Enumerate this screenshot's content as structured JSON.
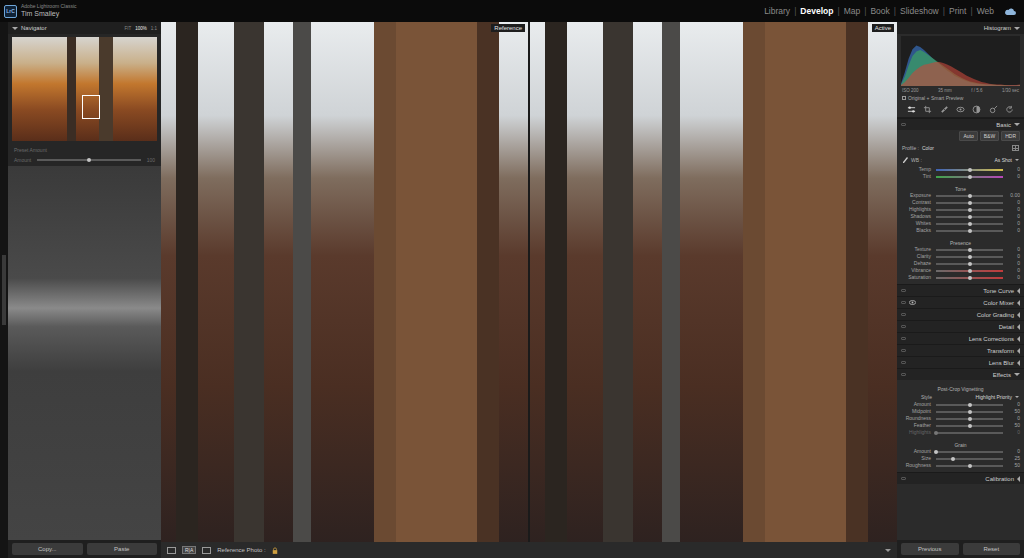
{
  "app": {
    "logo": "LrC",
    "product": "Adobe Lightroom Classic",
    "user": "Tim Smalley"
  },
  "modules": [
    {
      "label": "Library",
      "selected": false
    },
    {
      "label": "Develop",
      "selected": true
    },
    {
      "label": "Map",
      "selected": false
    },
    {
      "label": "Book",
      "selected": false
    },
    {
      "label": "Slideshow",
      "selected": false
    },
    {
      "label": "Print",
      "selected": false
    },
    {
      "label": "Web",
      "selected": false
    }
  ],
  "module_separator": "|",
  "navigator": {
    "title": "Navigator",
    "expanded": true,
    "zoom": [
      {
        "label": "FIT",
        "selected": false
      },
      {
        "label": "100%",
        "selected": true
      },
      {
        "label": "1:1",
        "selected": false
      }
    ]
  },
  "preset_amount": {
    "title": "Preset Amount",
    "disabled": true,
    "slider": {
      "label": "Amount",
      "level": 0.5,
      "reading": "100"
    }
  },
  "left_buttons": [
    "Copy...",
    "Paste"
  ],
  "views": [
    {
      "label": "Reference"
    },
    {
      "label": "Active"
    }
  ],
  "toolbar": {
    "mode": "R|A",
    "reference_label": "Reference Photo :"
  },
  "histogram": {
    "title": "Histogram",
    "expanded": true,
    "series": [
      {
        "name": "blue",
        "color": "#3a7bd5",
        "values": [
          5,
          30,
          60,
          80,
          88,
          85,
          78,
          70,
          62,
          55,
          48,
          40,
          34,
          28,
          22,
          18,
          14,
          11,
          8,
          6,
          5,
          4,
          3,
          3,
          2,
          2,
          2,
          1,
          1,
          1,
          1,
          2
        ]
      },
      {
        "name": "green",
        "color": "#3fae5a",
        "values": [
          3,
          20,
          45,
          65,
          75,
          78,
          74,
          68,
          62,
          56,
          50,
          44,
          38,
          32,
          26,
          21,
          17,
          13,
          10,
          8,
          6,
          5,
          4,
          3,
          3,
          2,
          2,
          2,
          1,
          1,
          1,
          2
        ]
      },
      {
        "name": "red",
        "color": "#c8473a",
        "values": [
          2,
          8,
          18,
          28,
          36,
          42,
          46,
          48,
          50,
          52,
          52,
          50,
          47,
          43,
          38,
          33,
          28,
          23,
          19,
          15,
          12,
          9,
          7,
          5,
          4,
          3,
          3,
          2,
          2,
          2,
          2,
          3
        ]
      }
    ],
    "info": [
      "ISO 200",
      "35 mm",
      "f / 5.6",
      "1/30 sec"
    ],
    "preview": "Original + Smart Preview"
  },
  "tools": [
    {
      "selected": true
    },
    {
      "selected": false
    },
    {
      "selected": false
    },
    {
      "selected": false
    },
    {
      "selected": false
    },
    {
      "selected": false
    },
    {
      "selected": false
    }
  ],
  "panels": [
    {
      "kind": "header",
      "label": "Basic",
      "expanded": true,
      "eye": false
    },
    {
      "kind": "buttons",
      "items": [
        "Auto",
        "B&W",
        "HDR"
      ]
    },
    {
      "kind": "select",
      "label": "Profile :",
      "value": "Color"
    },
    {
      "kind": "wb",
      "label": "WB :",
      "value": "As Shot"
    },
    {
      "kind": "slider",
      "label": "Temp",
      "level": 0.5,
      "reading": "0",
      "disabled": false,
      "colors": [
        "#3d63b8",
        "#d6c04b"
      ]
    },
    {
      "kind": "slider",
      "label": "Tint",
      "level": 0.5,
      "reading": "0",
      "disabled": false,
      "colors": [
        "#3fa64a",
        "#b846b8"
      ]
    },
    {
      "kind": "label",
      "label": "Tone"
    },
    {
      "kind": "slider",
      "label": "Exposure",
      "level": 0.5,
      "reading": "0.00",
      "disabled": false
    },
    {
      "kind": "slider",
      "label": "Contrast",
      "level": 0.5,
      "reading": "0",
      "disabled": false
    },
    {
      "kind": "slider",
      "label": "Highlights",
      "level": 0.5,
      "reading": "0",
      "disabled": false
    },
    {
      "kind": "slider",
      "label": "Shadows",
      "level": 0.5,
      "reading": "0",
      "disabled": false
    },
    {
      "kind": "slider",
      "label": "Whites",
      "level": 0.5,
      "reading": "0",
      "disabled": false
    },
    {
      "kind": "slider",
      "label": "Blacks",
      "level": 0.5,
      "reading": "0",
      "disabled": false
    },
    {
      "kind": "label",
      "label": "Presence"
    },
    {
      "kind": "slider",
      "label": "Texture",
      "level": 0.5,
      "reading": "0",
      "disabled": false
    },
    {
      "kind": "slider",
      "label": "Clarity",
      "level": 0.5,
      "reading": "0",
      "disabled": false
    },
    {
      "kind": "slider",
      "label": "Dehaze",
      "level": 0.5,
      "reading": "0",
      "disabled": false
    },
    {
      "kind": "slider",
      "label": "Vibrance",
      "level": 0.5,
      "reading": "0",
      "disabled": false,
      "colors": [
        "#6a6a6a",
        "#c23b3b"
      ]
    },
    {
      "kind": "slider",
      "label": "Saturation",
      "level": 0.5,
      "reading": "0",
      "disabled": false,
      "colors": [
        "#6a6a6a",
        "#c23b3b"
      ]
    },
    {
      "kind": "header",
      "label": "Tone Curve",
      "expanded": false,
      "eye": false
    },
    {
      "kind": "header",
      "label": "Color Mixer",
      "expanded": false,
      "eye": true
    },
    {
      "kind": "header",
      "label": "Color Grading",
      "expanded": false,
      "eye": false
    },
    {
      "kind": "header",
      "label": "Detail",
      "expanded": false,
      "eye": false
    },
    {
      "kind": "header",
      "label": "Lens Corrections",
      "expanded": false,
      "eye": false
    },
    {
      "kind": "header",
      "label": "Transform",
      "expanded": false,
      "eye": false
    },
    {
      "kind": "header",
      "label": "Lens Blur",
      "expanded": false,
      "eye": false
    },
    {
      "kind": "header",
      "label": "Effects",
      "expanded": true,
      "eye": false
    },
    {
      "kind": "label",
      "label": "Post-Crop Vignetting"
    },
    {
      "kind": "style",
      "label": "Style",
      "value": "Highlight Priority"
    },
    {
      "kind": "slider",
      "label": "Amount",
      "level": 0.5,
      "reading": "0",
      "disabled": false
    },
    {
      "kind": "slider",
      "label": "Midpoint",
      "level": 0.5,
      "reading": "50",
      "disabled": false
    },
    {
      "kind": "slider",
      "label": "Roundness",
      "level": 0.5,
      "reading": "0",
      "disabled": false
    },
    {
      "kind": "slider",
      "label": "Feather",
      "level": 0.5,
      "reading": "50",
      "disabled": false
    },
    {
      "kind": "slider",
      "label": "Highlights",
      "level": 0.0,
      "reading": "0",
      "disabled": true
    },
    {
      "kind": "label",
      "label": "Grain"
    },
    {
      "kind": "slider",
      "label": "Amount",
      "level": 0.0,
      "reading": "0",
      "disabled": false
    },
    {
      "kind": "slider",
      "label": "Size",
      "level": 0.25,
      "reading": "25",
      "disabled": false
    },
    {
      "kind": "slider",
      "label": "Roughness",
      "level": 0.5,
      "reading": "50",
      "disabled": false
    },
    {
      "kind": "header",
      "label": "Calibration",
      "expanded": false,
      "eye": false
    }
  ],
  "right_buttons": [
    "Previous",
    "Reset"
  ]
}
